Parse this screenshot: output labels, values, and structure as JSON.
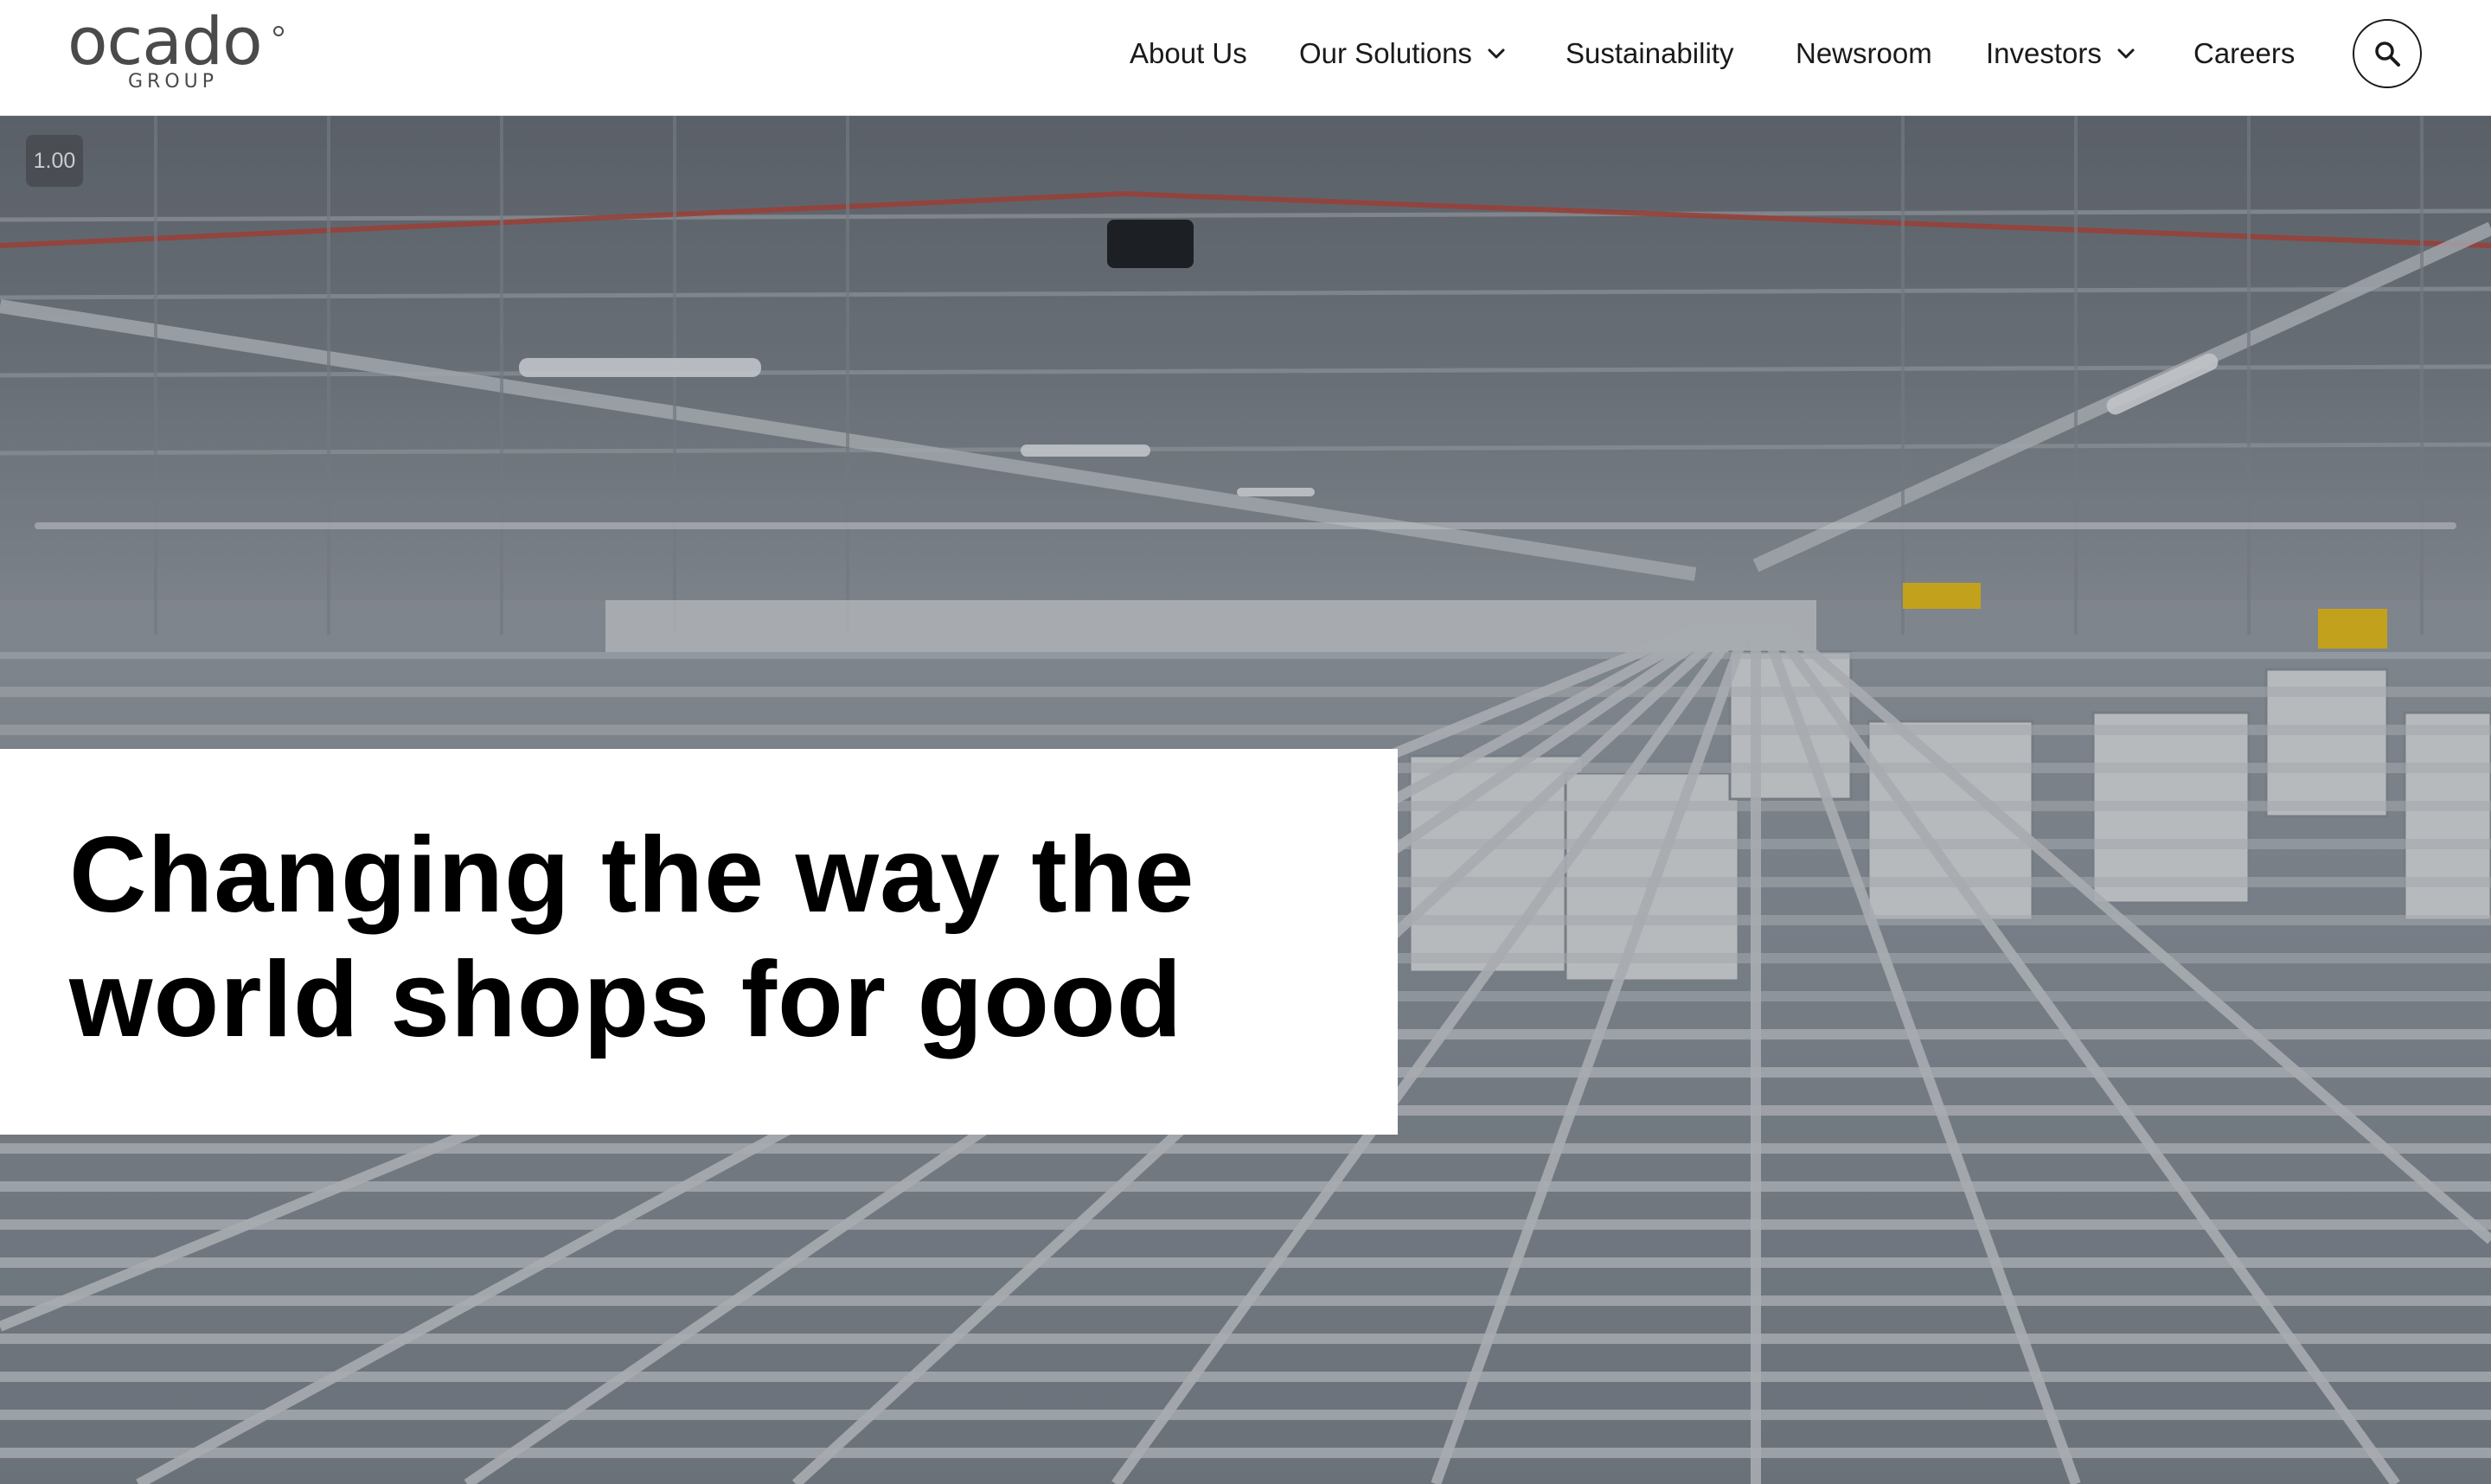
{
  "brand": {
    "name": "ocado",
    "subname": "GROUP"
  },
  "nav": {
    "items": [
      {
        "label": "About Us",
        "has_dropdown": false
      },
      {
        "label": "Our Solutions",
        "has_dropdown": true
      },
      {
        "label": "Sustainability",
        "has_dropdown": false
      },
      {
        "label": "Newsroom",
        "has_dropdown": false
      },
      {
        "label": "Investors",
        "has_dropdown": true
      },
      {
        "label": "Careers",
        "has_dropdown": false
      }
    ],
    "search_icon": "search-icon",
    "dropdown_icon": "chevron-down-icon"
  },
  "hero": {
    "playback_speed": "1.00",
    "headline_line1": "Changing the way the",
    "headline_line2": "world shops for good",
    "image_subject": "automated warehouse grid with robots"
  },
  "colors": {
    "text": "#111111",
    "header_bg": "#ffffff",
    "headline_box_bg": "#ffffff",
    "hero_tone": "#6e7680"
  }
}
